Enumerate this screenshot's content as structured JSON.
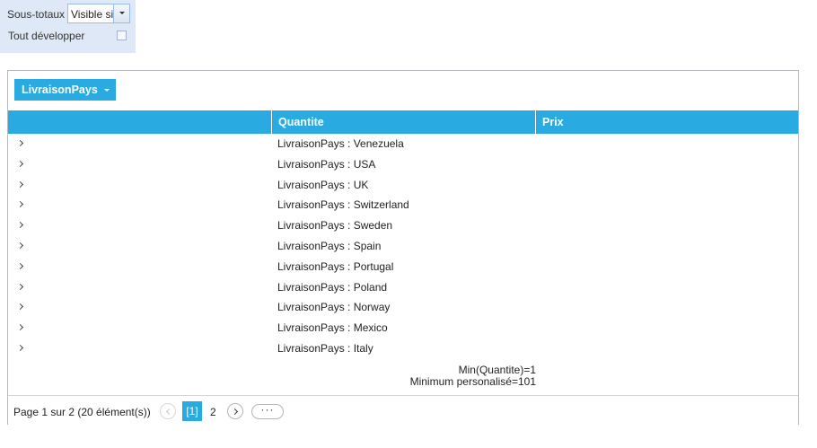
{
  "options": {
    "subtotals_label": "Sous-totaux",
    "subtotals_value": "Visible si",
    "expand_all_label": "Tout développer",
    "expand_all_checked": false
  },
  "grid": {
    "field_button": "LivraisonPays",
    "columns": [
      "",
      "Quantite",
      "Prix"
    ],
    "rows": [
      "LivraisonPays : Venezuela",
      "LivraisonPays : USA",
      "LivraisonPays : UK",
      "LivraisonPays : Switzerland",
      "LivraisonPays : Sweden",
      "LivraisonPays : Spain",
      "LivraisonPays : Portugal",
      "LivraisonPays : Poland",
      "LivraisonPays : Norway",
      "LivraisonPays : Mexico",
      "LivraisonPays : Italy"
    ],
    "summary": [
      "Min(Quantite)=1",
      "Minimum personalisé=101"
    ]
  },
  "pager": {
    "info": "Page 1 sur 2 (20 élément(s))",
    "current_page": "[1]",
    "next_page": "2",
    "more": "···"
  },
  "colors": {
    "accent": "#29abe2",
    "panel": "#dfe8f6"
  }
}
